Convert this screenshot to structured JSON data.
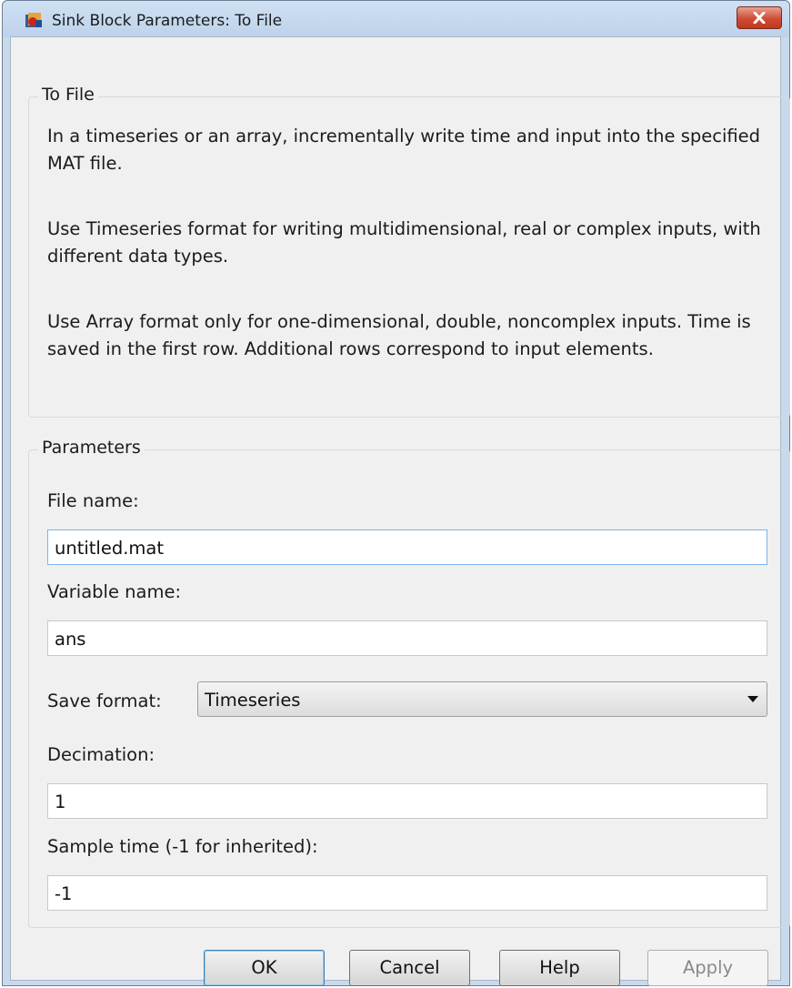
{
  "window": {
    "title": "Sink Block Parameters: To File",
    "icon": "simulink-block-icon",
    "close_icon": "close-icon"
  },
  "to_file_group": {
    "legend": "To File",
    "paragraphs": [
      "In a timeseries or an array, incrementally write time and input into the specified MAT file.",
      "Use Timeseries format for writing multidimensional, real or complex inputs, with different data types.",
      "Use Array format only for one-dimensional, double, noncomplex inputs. Time is saved in the first row.  Additional rows correspond to input elements."
    ]
  },
  "parameters_group": {
    "legend": "Parameters",
    "file_name": {
      "label": "File name:",
      "value": "untitled.mat"
    },
    "variable_name": {
      "label": "Variable name:",
      "value": "ans"
    },
    "save_format": {
      "label": "Save format:",
      "value": "Timeseries"
    },
    "decimation": {
      "label": "Decimation:",
      "value": "1"
    },
    "sample_time": {
      "label": "Sample time (-1 for inherited):",
      "value": "-1"
    }
  },
  "buttons": {
    "ok": "OK",
    "cancel": "Cancel",
    "help": "Help",
    "apply": "Apply"
  },
  "colors": {
    "titlebar": "#c9d9ec",
    "client_bg": "#f0f0f0",
    "close_button": "#cf4b33",
    "focus_border": "#7eb4ea"
  }
}
